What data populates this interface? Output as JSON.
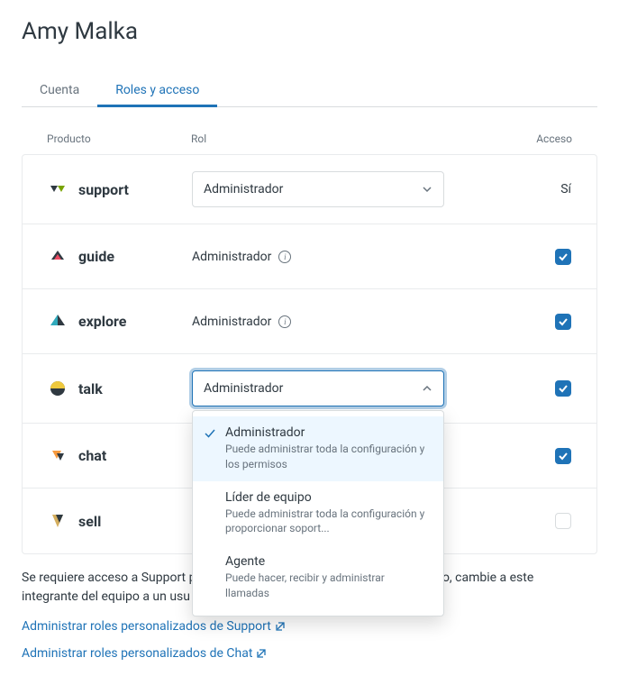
{
  "page_title": "Amy Malka",
  "tabs": {
    "account": "Cuenta",
    "roles": "Roles y acceso"
  },
  "columns": {
    "product": "Producto",
    "role": "Rol",
    "access": "Acceso"
  },
  "products": {
    "support": {
      "name": "support",
      "role": "Administrador",
      "access_text": "Sí"
    },
    "guide": {
      "name": "guide",
      "role": "Administrador"
    },
    "explore": {
      "name": "explore",
      "role": "Administrador"
    },
    "talk": {
      "name": "talk",
      "role": "Administrador"
    },
    "chat": {
      "name": "chat"
    },
    "sell": {
      "name": "sell"
    }
  },
  "dropdown": {
    "admin": {
      "title": "Administrador",
      "desc": "Puede administrar toda la configuración y los permisos"
    },
    "leader": {
      "title": "Líder de equipo",
      "desc": "Puede administrar toda la configuración y proporcionar soport..."
    },
    "agent": {
      "title": "Agente",
      "desc": "Puede hacer, recibir y administrar llamadas"
    }
  },
  "footer": {
    "note_a": "Se requiere acceso a Support p",
    "note_b": "el acceso, cambie a este",
    "note_c": "integrante del equipo a un usu",
    "link_support": "Administrar roles personalizados de Support",
    "link_chat": "Administrar roles personalizados de Chat"
  }
}
